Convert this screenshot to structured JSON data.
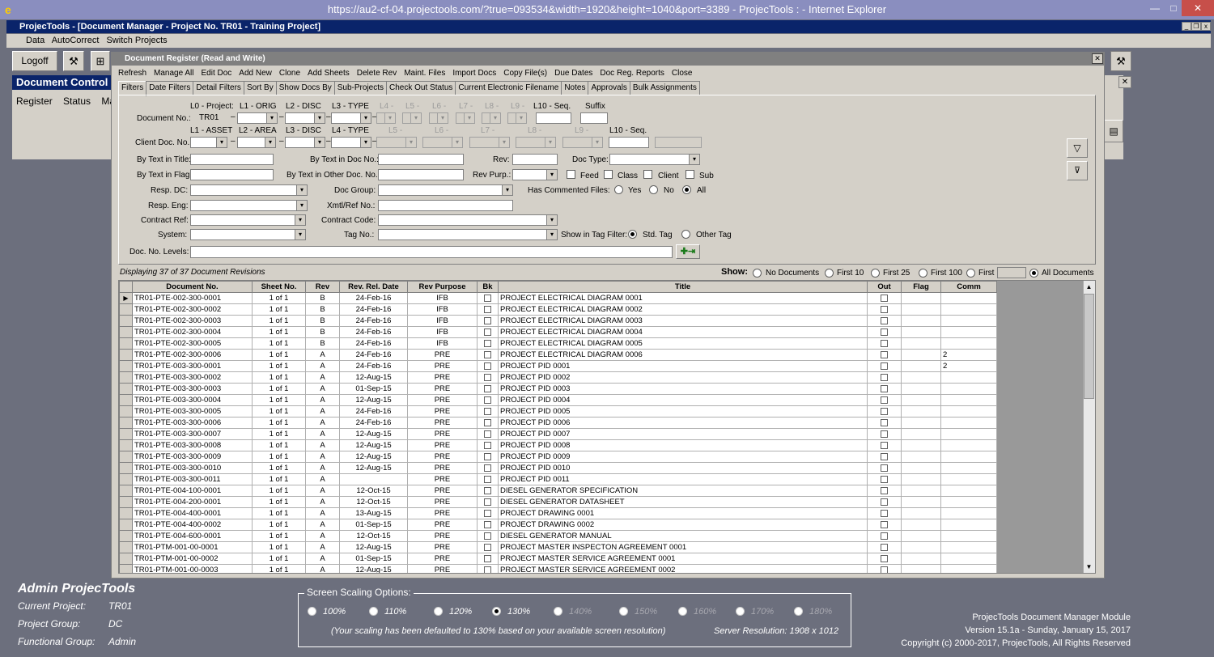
{
  "browser": {
    "url_title": "https://au2-cf-04.projectools.com/?true=093534&width=1920&height=1040&port=3389 - ProjecTools : - Internet Explorer"
  },
  "app": {
    "title": "ProjecTools - [Document Manager - Project No. TR01 - Training Project]",
    "menu": [
      "Data",
      "AutoCorrect",
      "Switch Projects"
    ],
    "logoff": "Logoff"
  },
  "doc_control": {
    "title": "Document Control",
    "links": [
      "Register",
      "Status",
      "Ma"
    ]
  },
  "dialog": {
    "title": "Document Register (Read and Write)",
    "menu": [
      "Refresh",
      "Manage All",
      "Edit Doc",
      "Add New",
      "Clone",
      "Add Sheets",
      "Delete Rev",
      "Maint. Files",
      "Import Docs",
      "Copy File(s)",
      "Due Dates",
      "Doc Reg. Reports",
      "Close"
    ],
    "tabs": [
      "Filters",
      "Date Filters",
      "Detail Filters",
      "Sort By",
      "Show Docs By",
      "Sub-Projects",
      "Check Out Status",
      "Current Electronic Filename",
      "Notes",
      "Approvals",
      "Bulk Assignments"
    ]
  },
  "filters": {
    "level_labels_top": [
      "L0 - Project:",
      "L1 - ORIG",
      "L2 - DISC",
      "L3 - TYPE",
      "L4 -",
      "L5 -",
      "L6 -",
      "L7 -",
      "L8 -",
      "L9 -",
      "L10 - Seq.",
      "Suffix"
    ],
    "level_labels_client": [
      "L1 - ASSET",
      "L2 - AREA",
      "L3 - DISC",
      "L4 - TYPE",
      "L5 -",
      "L6 -",
      "L7 -",
      "L8 -",
      "L9 -",
      "L10 - Seq."
    ],
    "doc_no_label": "Document No.:",
    "project_value": "TR01",
    "client_doc_label": "Client Doc. No.:",
    "by_title": "By Text in Title:",
    "by_doc_no": "By Text in Doc No.:",
    "rev": "Rev:",
    "doc_type": "Doc Type:",
    "by_flag": "By Text in Flag:",
    "by_other": "By Text in Other Doc. No.:",
    "rev_purp": "Rev Purp.:",
    "feed": "Feed",
    "class": "Class",
    "client": "Client",
    "sub": "Sub",
    "resp_dc": "Resp. DC:",
    "doc_group": "Doc Group:",
    "has_commented": "Has Commented Files:",
    "yes": "Yes",
    "no": "No",
    "all": "All",
    "resp_eng": "Resp. Eng:",
    "xmtl": "Xmtl/Ref No.:",
    "contract_ref": "Contract Ref:",
    "contract_code": "Contract Code:",
    "system": "System:",
    "tag_no": "Tag No.:",
    "show_tag": "Show in Tag Filter:",
    "std_tag": "Std. Tag",
    "other_tag": "Other Tag",
    "doc_levels": "Doc. No. Levels:"
  },
  "display": {
    "status": "Displaying 37 of 37 Document Revisions",
    "show_label": "Show:",
    "options": [
      "No Documents",
      "First 10",
      "First 25",
      "First 100",
      "First",
      "All Documents"
    ]
  },
  "grid": {
    "headers": [
      "Document No.",
      "Sheet No.",
      "Rev",
      "Rev. Rel. Date",
      "Rev Purpose",
      "Bk",
      "Title",
      "Out",
      "Flag",
      "Comm"
    ],
    "rows": [
      [
        "TR01-PTE-002-300-0001",
        "1 of 1",
        "B",
        "24-Feb-16",
        "IFB",
        "PROJECT ELECTRICAL DIAGRAM 0001",
        ""
      ],
      [
        "TR01-PTE-002-300-0002",
        "1 of 1",
        "B",
        "24-Feb-16",
        "IFB",
        "PROJECT ELECTRICAL DIAGRAM 0002",
        ""
      ],
      [
        "TR01-PTE-002-300-0003",
        "1 of 1",
        "B",
        "24-Feb-16",
        "IFB",
        "PROJECT ELECTRICAL DIAGRAM 0003",
        ""
      ],
      [
        "TR01-PTE-002-300-0004",
        "1 of 1",
        "B",
        "24-Feb-16",
        "IFB",
        "PROJECT ELECTRICAL DIAGRAM 0004",
        ""
      ],
      [
        "TR01-PTE-002-300-0005",
        "1 of 1",
        "B",
        "24-Feb-16",
        "IFB",
        "PROJECT ELECTRICAL DIAGRAM 0005",
        ""
      ],
      [
        "TR01-PTE-002-300-0006",
        "1 of 1",
        "A",
        "24-Feb-16",
        "PRE",
        "PROJECT ELECTRICAL DIAGRAM 0006",
        "2"
      ],
      [
        "TR01-PTE-003-300-0001",
        "1 of 1",
        "A",
        "24-Feb-16",
        "PRE",
        "PROJECT PID 0001",
        "2"
      ],
      [
        "TR01-PTE-003-300-0002",
        "1 of 1",
        "A",
        "12-Aug-15",
        "PRE",
        "PROJECT PID 0002",
        ""
      ],
      [
        "TR01-PTE-003-300-0003",
        "1 of 1",
        "A",
        "01-Sep-15",
        "PRE",
        "PROJECT PID 0003",
        ""
      ],
      [
        "TR01-PTE-003-300-0004",
        "1 of 1",
        "A",
        "12-Aug-15",
        "PRE",
        "PROJECT PID 0004",
        ""
      ],
      [
        "TR01-PTE-003-300-0005",
        "1 of 1",
        "A",
        "24-Feb-16",
        "PRE",
        "PROJECT PID 0005",
        ""
      ],
      [
        "TR01-PTE-003-300-0006",
        "1 of 1",
        "A",
        "24-Feb-16",
        "PRE",
        "PROJECT PID 0006",
        ""
      ],
      [
        "TR01-PTE-003-300-0007",
        "1 of 1",
        "A",
        "12-Aug-15",
        "PRE",
        "PROJECT PID 0007",
        ""
      ],
      [
        "TR01-PTE-003-300-0008",
        "1 of 1",
        "A",
        "12-Aug-15",
        "PRE",
        "PROJECT PID 0008",
        ""
      ],
      [
        "TR01-PTE-003-300-0009",
        "1 of 1",
        "A",
        "12-Aug-15",
        "PRE",
        "PROJECT PID 0009",
        ""
      ],
      [
        "TR01-PTE-003-300-0010",
        "1 of 1",
        "A",
        "12-Aug-15",
        "PRE",
        "PROJECT PID 0010",
        ""
      ],
      [
        "TR01-PTE-003-300-0011",
        "1 of 1",
        "A",
        "",
        "PRE",
        "PROJECT PID 0011",
        ""
      ],
      [
        "TR01-PTE-004-100-0001",
        "1 of 1",
        "A",
        "12-Oct-15",
        "PRE",
        "DIESEL GENERATOR SPECIFICATION",
        ""
      ],
      [
        "TR01-PTE-004-200-0001",
        "1 of 1",
        "A",
        "12-Oct-15",
        "PRE",
        "DIESEL GENERATOR DATASHEET",
        ""
      ],
      [
        "TR01-PTE-004-400-0001",
        "1 of 1",
        "A",
        "13-Aug-15",
        "PRE",
        "PROJECT DRAWING 0001",
        ""
      ],
      [
        "TR01-PTE-004-400-0002",
        "1 of 1",
        "A",
        "01-Sep-15",
        "PRE",
        "PROJECT DRAWING 0002",
        ""
      ],
      [
        "TR01-PTE-004-600-0001",
        "1 of 1",
        "A",
        "12-Oct-15",
        "PRE",
        "DIESEL GENERATOR MANUAL",
        ""
      ],
      [
        "TR01-PTM-001-00-0001",
        "1 of 1",
        "A",
        "12-Aug-15",
        "PRE",
        "PROJECT MASTER INSPECTON AGREEMENT 0001",
        ""
      ],
      [
        "TR01-PTM-001-00-0002",
        "1 of 1",
        "A",
        "01-Sep-15",
        "PRE",
        "PROJECT MASTER SERVICE AGREEMENT 0001",
        ""
      ],
      [
        "TR01-PTM-001-00-0003",
        "1 of 1",
        "A",
        "12-Aug-15",
        "PRE",
        "PROJECT MASTER SERVICE AGREEMENT 0002",
        ""
      ]
    ]
  },
  "bottom": {
    "admin": "Admin  ProjecTools",
    "current_project_label": "Current Project:",
    "current_project": "TR01",
    "project_group_label": "Project Group:",
    "project_group": "DC",
    "functional_group_label": "Functional Group:",
    "functional_group": "Admin",
    "scaling_title": "Screen Scaling Options:",
    "scales": [
      "100%",
      "110%",
      "120%",
      "130%",
      "140%",
      "150%",
      "160%",
      "170%",
      "180%"
    ],
    "scale_note": "(Your scaling has been defaulted to 130% based on your available screen resolution)",
    "server_res": "Server Resolution: 1908 x 1012",
    "module": "ProjecTools Document Manager Module",
    "version": "Version 15.1a - Sunday, January 15, 2017",
    "copyright": "Copyright (c) 2000-2017, ProjecTools, All Rights Reserved"
  }
}
